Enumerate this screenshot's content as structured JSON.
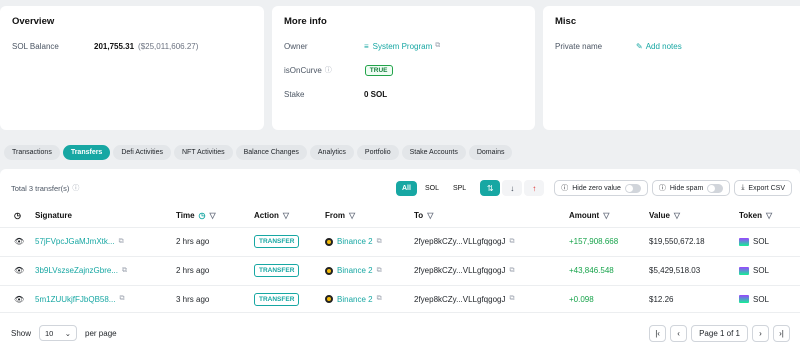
{
  "overview": {
    "title": "Overview",
    "sol_label": "SOL Balance",
    "sol_value": "201,755.31",
    "sol_usd": "($25,011,606.27)"
  },
  "more_info": {
    "title": "More info",
    "owner_label": "Owner",
    "owner_value": "System Program",
    "oncurve_label": "isOnCurve",
    "oncurve_value": "TRUE",
    "stake_label": "Stake",
    "stake_value": "0 SOL"
  },
  "misc": {
    "title": "Misc",
    "private_label": "Private name",
    "add_notes": "Add notes"
  },
  "tabs": [
    "Transactions",
    "Transfers",
    "Defi Activities",
    "NFT Activities",
    "Balance Changes",
    "Analytics",
    "Portfolio",
    "Stake Accounts",
    "Domains"
  ],
  "toolbar": {
    "total": "Total 3 transfer(s)",
    "filters": [
      "All",
      "SOL",
      "SPL"
    ],
    "hide_zero": "Hide zero value",
    "hide_spam": "Hide spam",
    "export": "Export CSV"
  },
  "table": {
    "headers": {
      "signature": "Signature",
      "time": "Time",
      "action": "Action",
      "from": "From",
      "to": "To",
      "amount": "Amount",
      "value": "Value",
      "token": "Token"
    },
    "rows": [
      {
        "signature": "57jFVpcJGaMJmXtk...",
        "time": "2 hrs ago",
        "action": "TRANSFER",
        "from": "Binance 2",
        "to": "2fyep8kCZy...VLLgfqgogJ",
        "amount": "+157,908.668",
        "value": "$19,550,672.18",
        "token": "SOL"
      },
      {
        "signature": "3b9LVszseZajnzGbre...",
        "time": "2 hrs ago",
        "action": "TRANSFER",
        "from": "Binance 2",
        "to": "2fyep8kCZy...VLLgfqgogJ",
        "amount": "+43,846.548",
        "value": "$5,429,518.03",
        "token": "SOL"
      },
      {
        "signature": "5m1ZUUkjfFJbQB58...",
        "time": "3 hrs ago",
        "action": "TRANSFER",
        "from": "Binance 2",
        "to": "2fyep8kCZy...VLLgfqgogJ",
        "amount": "+0.098",
        "value": "$12.26",
        "token": "SOL"
      }
    ]
  },
  "footer": {
    "show": "Show",
    "page_size": "10",
    "per_page": "per page",
    "page_info": "Page 1 of 1"
  },
  "colors": {
    "accent": "#17a7a3",
    "positive": "#16a34a",
    "binance": "#f0b90b"
  }
}
